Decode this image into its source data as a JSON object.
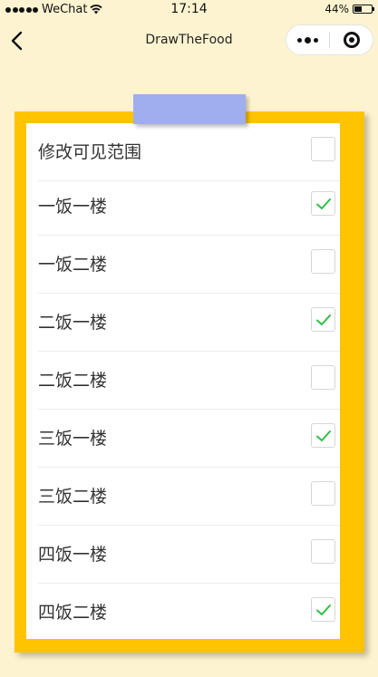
{
  "status_bar": {
    "carrier": "WeChat",
    "time": "17:14",
    "battery_percent": "44%",
    "battery_level": 0.44
  },
  "nav": {
    "title": "DrawTheFood"
  },
  "colors": {
    "background": "#fef3d0",
    "frame": "#ffc300",
    "clip_tab": "#a0aef0",
    "check_mark": "#2ebf46"
  },
  "options": [
    {
      "label": "修改可见范围",
      "checked": false
    },
    {
      "label": "一饭一楼",
      "checked": true
    },
    {
      "label": "一饭二楼",
      "checked": false
    },
    {
      "label": "二饭一楼",
      "checked": true
    },
    {
      "label": "二饭二楼",
      "checked": false
    },
    {
      "label": "三饭一楼",
      "checked": true
    },
    {
      "label": "三饭二楼",
      "checked": false
    },
    {
      "label": "四饭一楼",
      "checked": false
    },
    {
      "label": "四饭二楼",
      "checked": true
    }
  ]
}
